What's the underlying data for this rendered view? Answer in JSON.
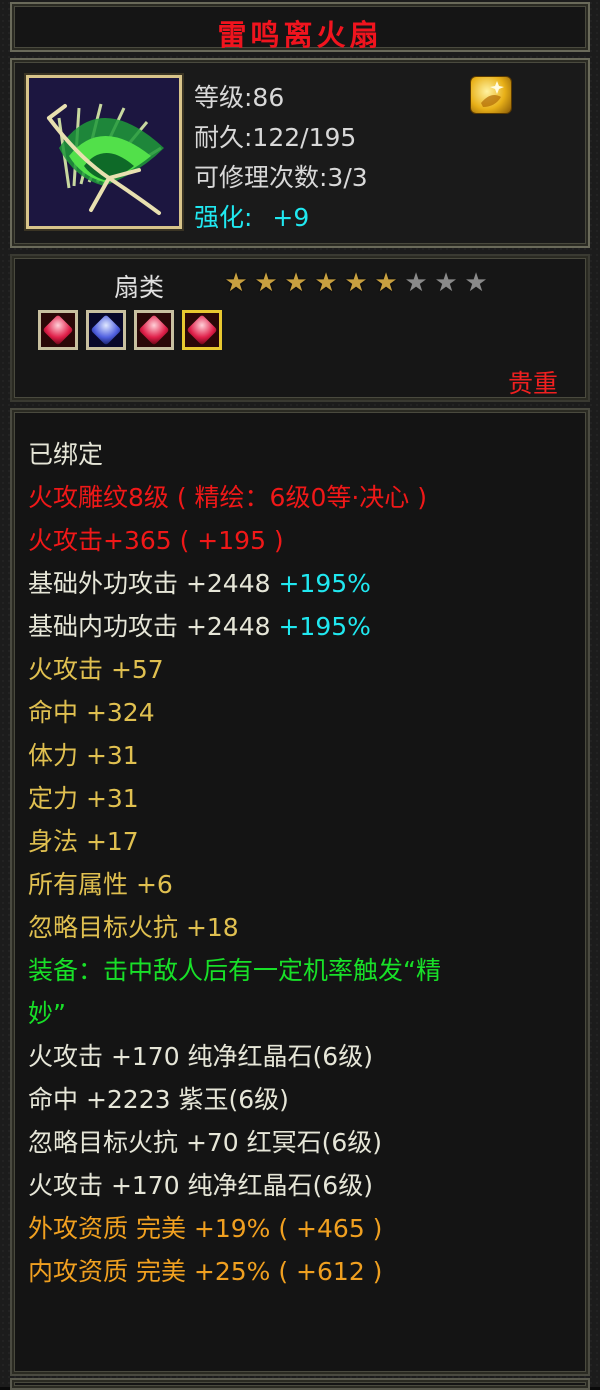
{
  "item": {
    "name": "雷鸣离火扇",
    "level": "等级:86",
    "durability": "耐久:122/195",
    "repair": "可修理次数:3/3",
    "enhance_label": "强化:",
    "enhance_value": "+9",
    "category": "扇类",
    "stars_filled": 6,
    "stars_total": 9,
    "quality": "贵重",
    "gems": [
      "red-gem",
      "blue-gem",
      "red-gem",
      "red-gem"
    ]
  },
  "details": {
    "bound": "已绑定",
    "engrave": "火攻雕纹8级 ( 精绘：6级0等·决心 )",
    "fire_attack_red": "火攻击+365 ( +195 )",
    "base_ext_label": "基础外功攻击 +2448",
    "base_ext_pct": "+195%",
    "base_int_label": "基础内功攻击 +2448",
    "base_int_pct": "+195%",
    "fire_attack": "火攻击 +57",
    "hit": "命中 +324",
    "stamina": "体力 +31",
    "focus": "定力 +31",
    "agility": "身法 +17",
    "all_attr": "所有属性 +6",
    "ignore_fire": "忽略目标火抗 +18",
    "equip_effect_1": "装备：击中敌人后有一定机率触发“精",
    "equip_effect_2": "妙”",
    "gem1": "火攻击 +170 纯净红晶石(6级)",
    "gem2": "命中 +2223 紫玉(6级)",
    "gem3": "忽略目标火抗 +70 红冥石(6级)",
    "gem4": "火攻击 +170 纯净红晶石(6级)",
    "apt_ext": "外攻资质  完美 +19% ( +465 )",
    "apt_int": "内攻资质  完美 +25% ( +612 )"
  }
}
